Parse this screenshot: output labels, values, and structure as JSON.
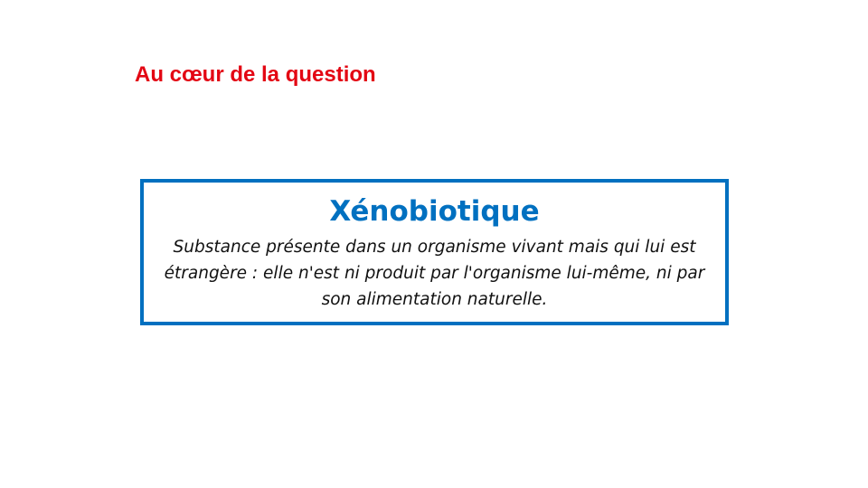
{
  "slide": {
    "section_title": "Au cœur de la question",
    "definition_box": {
      "term": "Xénobiotique",
      "definition": "Substance présente dans un organisme vivant mais qui lui est étrangère : elle n'est ni produit par l'organisme lui-même, ni par son alimentation naturelle."
    }
  },
  "colors": {
    "title": "#e30613",
    "accent": "#0070c0",
    "text": "#111111",
    "background": "#ffffff"
  }
}
